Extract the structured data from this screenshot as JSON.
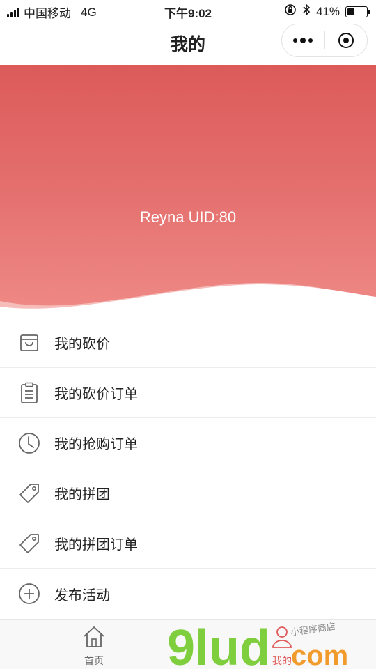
{
  "status": {
    "carrier": "中国移动",
    "network": "4G",
    "time": "下午9:02",
    "battery_text": "41%",
    "battery_level": 0.41
  },
  "nav": {
    "title": "我的"
  },
  "profile": {
    "user_line": "Reyna UID:80"
  },
  "menu": {
    "items": [
      {
        "label": "我的砍价",
        "icon": "shopping-bag-icon"
      },
      {
        "label": "我的砍价订单",
        "icon": "clipboard-list-icon"
      },
      {
        "label": "我的抢购订单",
        "icon": "clock-icon"
      },
      {
        "label": "我的拼团",
        "icon": "tag-icon"
      },
      {
        "label": "我的拼团订单",
        "icon": "tag-icon"
      },
      {
        "label": "发布活动",
        "icon": "plus-circle-icon"
      }
    ]
  },
  "tabbar": {
    "tabs": [
      {
        "label": "首页",
        "icon": "home-icon"
      },
      {
        "label": "我的",
        "icon": "user-icon"
      }
    ]
  },
  "watermark": {
    "brand": "9lud",
    "suffix": "com",
    "tagline": "小程序商店"
  },
  "colors": {
    "header_top": "#dc5a5a",
    "header_bottom": "#ef8a86",
    "watermark_green": "#7fce3e",
    "watermark_orange": "#f29b2d"
  }
}
